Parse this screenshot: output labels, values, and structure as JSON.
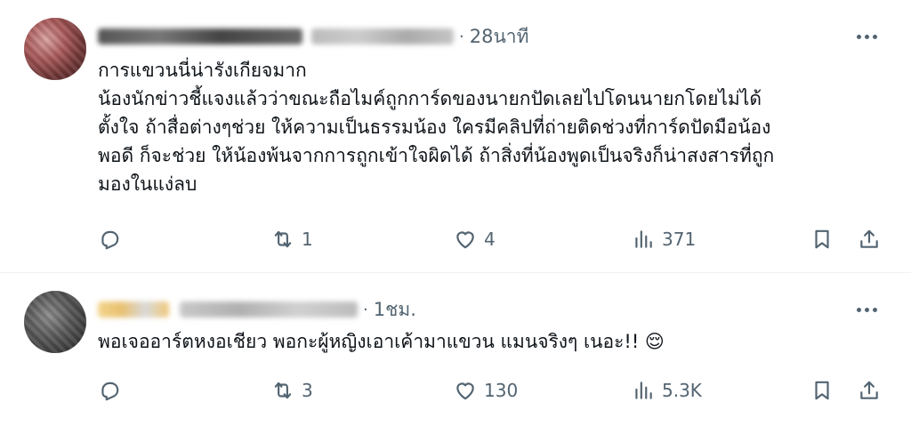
{
  "tweets": [
    {
      "time": "28นาที",
      "separator": "·",
      "text": "การแขวนนี่น่ารังเกียจมาก\nน้องนักข่าวชี้แจงแล้วว่าขณะถือไมค์ถูกการ์ดของนายกปัดเลยไปโดนนายกโดยไม่ได้\nตั้งใจ ถ้าสื่อต่างๆช่วย ให้ความเป็นธรรมน้อง ใครมีคลิปที่ถ่ายติดช่วงที่การ์ดปัดมือน้อง\nพอดี ก็จะช่วย ให้น้องพ้นจากการถูกเข้าใจผิดได้ ถ้าสิ่งที่น้องพูดเป็นจริงก็น่าสงสารที่ถูก\nมองในแง่ลบ",
      "replies": "",
      "retweets": "1",
      "likes": "4",
      "views": "371"
    },
    {
      "time": "1ชม.",
      "separator": "·",
      "text": "พอเจออาร์ตหงอเชียว พอกะผู้หญิงเอาเค้ามาแขวน แมนจริงๆ เนอะ!! 😌",
      "replies": "",
      "retweets": "3",
      "likes": "130",
      "views": "5.3K"
    }
  ],
  "icons": {
    "reply": "reply-icon",
    "retweet": "retweet-icon",
    "like": "heart-icon",
    "views": "views-icon",
    "bookmark": "bookmark-icon",
    "share": "share-icon",
    "more": "more-icon"
  },
  "colors": {
    "text": "#0f1419",
    "secondary": "#536471",
    "divider": "#eff3f4"
  }
}
